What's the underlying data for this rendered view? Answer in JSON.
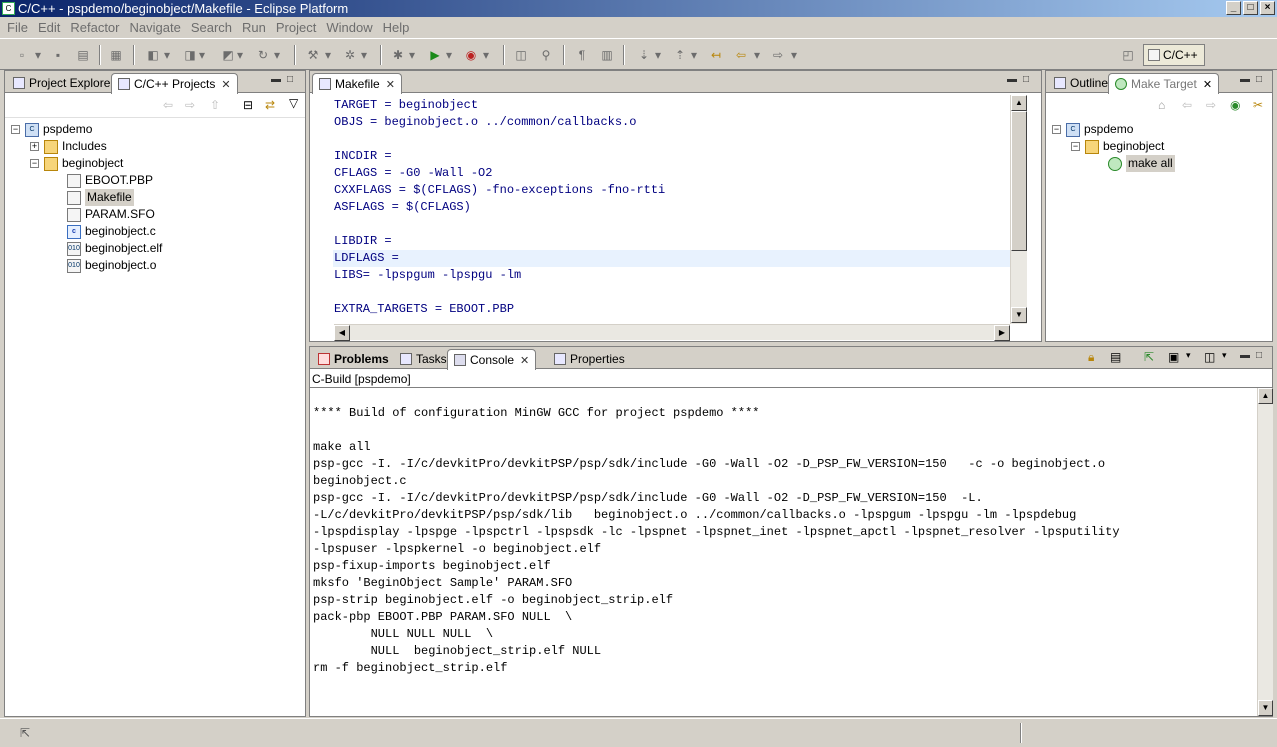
{
  "window": {
    "title": "C/C++ - pspdemo/beginobject/Makefile - Eclipse Platform"
  },
  "menu": [
    "File",
    "Edit",
    "Refactor",
    "Navigate",
    "Search",
    "Run",
    "Project",
    "Window",
    "Help"
  ],
  "perspective": {
    "label": "C/C++"
  },
  "left_panel": {
    "tabs": [
      {
        "label": "Project Explorer"
      },
      {
        "label": "C/C++ Projects"
      }
    ],
    "tree": [
      {
        "label": "pspdemo"
      },
      {
        "label": "Includes"
      },
      {
        "label": "beginobject"
      },
      {
        "label": "EBOOT.PBP"
      },
      {
        "label": "Makefile"
      },
      {
        "label": "PARAM.SFO"
      },
      {
        "label": "beginobject.c"
      },
      {
        "label": "beginobject.elf"
      },
      {
        "label": "beginobject.o"
      }
    ]
  },
  "editor": {
    "tab": "Makefile",
    "lines": [
      "TARGET = beginobject",
      "OBJS = beginobject.o ../common/callbacks.o",
      "",
      "INCDIR =",
      "CFLAGS = -G0 -Wall -O2",
      "CXXFLAGS = $(CFLAGS) -fno-exceptions -fno-rtti",
      "ASFLAGS = $(CFLAGS)",
      "",
      "LIBDIR =",
      "LDFLAGS =",
      "LIBS= -lpspgum -lpspgu -lm",
      "",
      "EXTRA_TARGETS = EBOOT.PBP"
    ]
  },
  "right_panel": {
    "tabs": [
      {
        "label": "Outline"
      },
      {
        "label": "Make Target"
      }
    ],
    "tree": [
      {
        "label": "pspdemo"
      },
      {
        "label": "beginobject"
      },
      {
        "label": "make all"
      }
    ]
  },
  "bottom_panel": {
    "tabs": [
      {
        "label": "Problems"
      },
      {
        "label": "Tasks"
      },
      {
        "label": "Console"
      },
      {
        "label": "Properties"
      }
    ],
    "console_title": "C-Build [pspdemo]",
    "lines": [
      "",
      "**** Build of configuration MinGW GCC for project pspdemo ****",
      "",
      "make all",
      "psp-gcc -I. -I/c/devkitPro/devkitPSP/psp/sdk/include -G0 -Wall -O2 -D_PSP_FW_VERSION=150   -c -o beginobject.o",
      "beginobject.c",
      "psp-gcc -I. -I/c/devkitPro/devkitPSP/psp/sdk/include -G0 -Wall -O2 -D_PSP_FW_VERSION=150  -L.",
      "-L/c/devkitPro/devkitPSP/psp/sdk/lib   beginobject.o ../common/callbacks.o -lpspgum -lpspgu -lm -lpspdebug",
      "-lpspdisplay -lpspge -lpspctrl -lpspsdk -lc -lpspnet -lpspnet_inet -lpspnet_apctl -lpspnet_resolver -lpsputility",
      "-lpspuser -lpspkernel -o beginobject.elf",
      "psp-fixup-imports beginobject.elf",
      "mksfo 'BeginObject Sample' PARAM.SFO",
      "psp-strip beginobject.elf -o beginobject_strip.elf",
      "pack-pbp EBOOT.PBP PARAM.SFO NULL  \\",
      "        NULL NULL NULL  \\",
      "        NULL  beginobject_strip.elf NULL",
      "rm -f beginobject_strip.elf"
    ]
  }
}
